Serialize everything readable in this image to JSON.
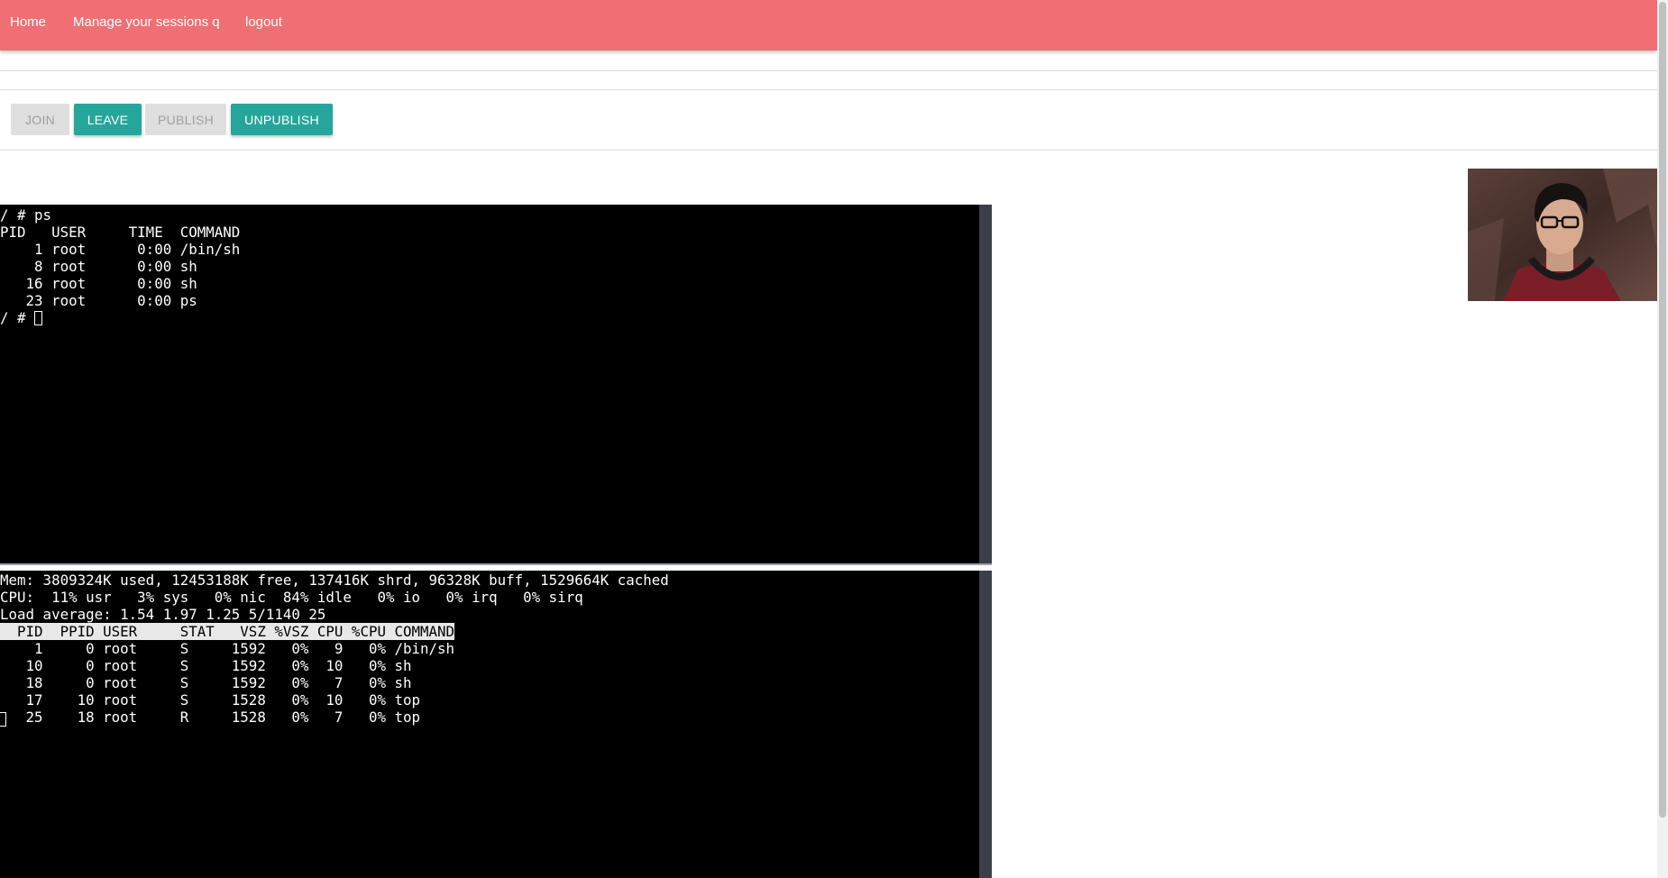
{
  "nav": {
    "home": "Home",
    "sessions": "Manage your sessions q",
    "logout": "logout"
  },
  "buttons": {
    "join": "JOIN",
    "leave": "LEAVE",
    "publish": "PUBLISH",
    "unpublish": "UNPUBLISH"
  },
  "terminal1": {
    "lines": [
      "/ # ps",
      "PID   USER     TIME  COMMAND",
      "    1 root      0:00 /bin/sh",
      "    8 root      0:00 sh",
      "   16 root      0:00 sh",
      "   23 root      0:00 ps"
    ],
    "prompt": "/ # "
  },
  "terminal2": {
    "mem": "Mem: 3809324K used, 12453188K free, 137416K shrd, 96328K buff, 1529664K cached",
    "cpu": "CPU:  11% usr   3% sys   0% nic  84% idle   0% io   0% irq   0% sirq",
    "load": "Load average: 1.54 1.97 1.25 5/1140 25",
    "header": "  PID  PPID USER     STAT   VSZ %VSZ CPU %CPU COMMAND",
    "rows": [
      "    1     0 root     S     1592   0%   9   0% /bin/sh",
      "   10     0 root     S     1592   0%  10   0% sh",
      "   18     0 root     S     1592   0%   7   0% sh",
      "   17    10 root     S     1528   0%  10   0% top",
      "   25    18 root     R     1528   0%   7   0% top"
    ]
  },
  "colors": {
    "navbar": "#ef6f74",
    "accent": "#26a69a",
    "disabled": "#dfdfdf"
  }
}
